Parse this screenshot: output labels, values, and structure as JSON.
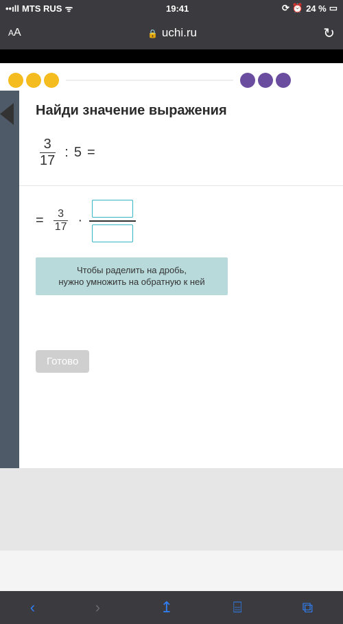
{
  "status": {
    "carrier": "MTS RUS",
    "time": "19:41",
    "battery_pct": "24 %"
  },
  "browser": {
    "aa_small": "A",
    "aa_big": "A",
    "host": "uchi.ru",
    "reload_glyph": "↻"
  },
  "lesson": {
    "heading": "Найди значение выражения",
    "expr1": {
      "num": "3",
      "den": "17",
      "op": ":",
      "rhs": "5",
      "eq": "="
    },
    "expr2": {
      "eq": "=",
      "num": "3",
      "den": "17",
      "op": "·",
      "inp_num": "",
      "inp_den": ""
    },
    "hint_line1": "Чтобы раделить на дробь,",
    "hint_line2": "нужно умножить на обратную к ней",
    "done": "Готово"
  },
  "toolbar": {
    "back": "‹",
    "fwd": "›",
    "share": "↥",
    "book": "⌸",
    "tabs": "⧉"
  }
}
